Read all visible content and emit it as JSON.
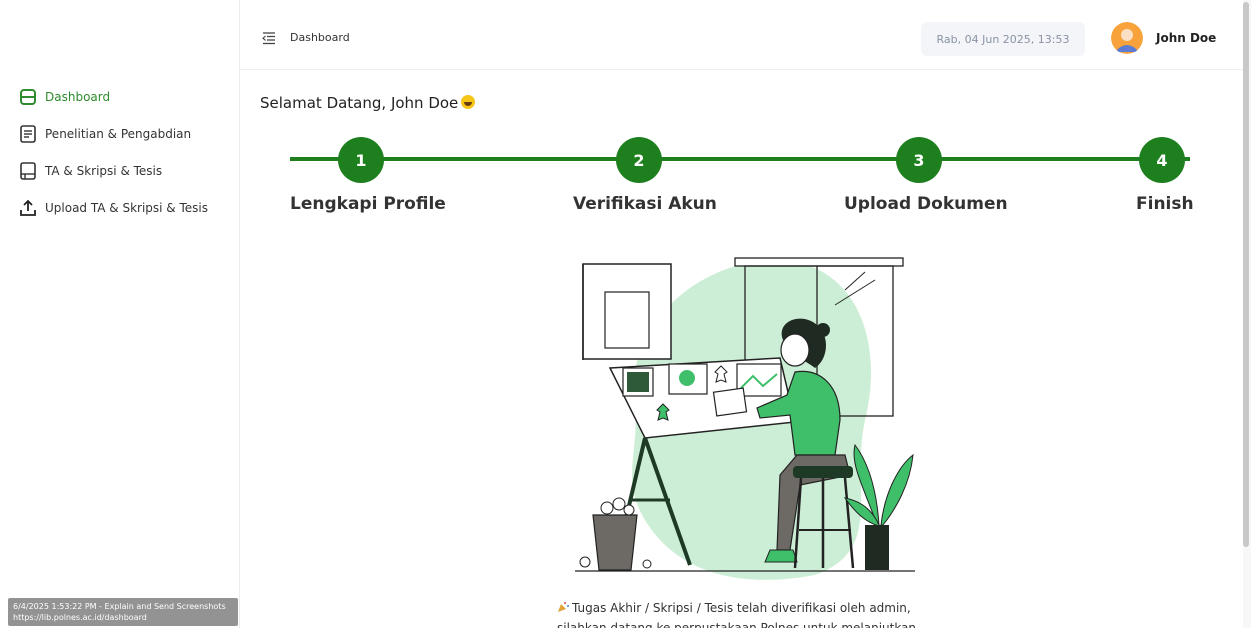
{
  "sidebar": {
    "items": [
      {
        "label": "Dashboard",
        "icon": "dashboard-icon",
        "active": true
      },
      {
        "label": "Penelitian & Pengabdian",
        "icon": "document-icon",
        "active": false
      },
      {
        "label": "TA & Skripsi & Tesis",
        "icon": "book-icon",
        "active": false
      },
      {
        "label": "Upload TA & Skripsi & Tesis",
        "icon": "upload-icon",
        "active": false
      }
    ]
  },
  "header": {
    "breadcrumb": "Dashboard",
    "menu_icon": "menu-icon",
    "datetime": "Rab, 04 Jun 2025, 13:53",
    "user_name": "John Doe"
  },
  "main": {
    "welcome": "Selamat Datang, John Doe",
    "steps": [
      {
        "number": "1",
        "label": "Lengkapi Profile"
      },
      {
        "number": "2",
        "label": "Verifikasi Akun"
      },
      {
        "number": "3",
        "label": "Upload Dokumen"
      },
      {
        "number": "4",
        "label": "Finish"
      }
    ],
    "message_line1": "Tugas Akhir / Skripsi / Tesis telah diverifikasi oleh admin,",
    "message_line2": "silahkan datang ke perpustakaan Polnes untuk melanjutkan"
  },
  "overlay": {
    "line1": "6/4/2025 1:53:22 PM - Explain and Send Screenshots",
    "line2": "https://lib.polnes.ac.id/dashboard"
  },
  "colors": {
    "accent": "#1e7f1e",
    "active_nav": "#2e8b2e",
    "blob": "#cdeed6",
    "shirt": "#3fbf6a"
  }
}
